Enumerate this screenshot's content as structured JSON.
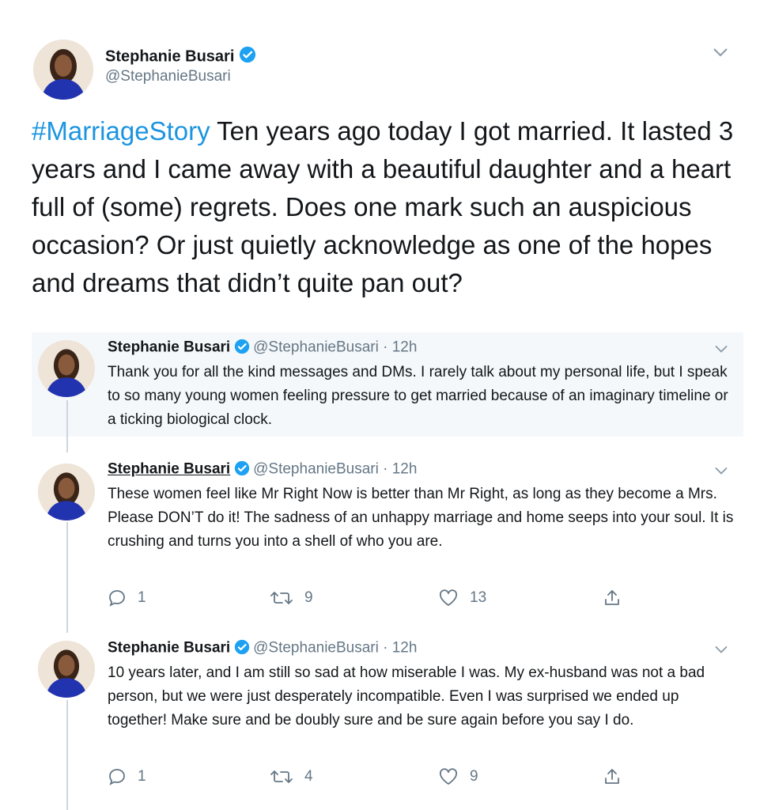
{
  "main_tweet": {
    "name": "Stephanie Busari",
    "handle": "@StephanieBusari",
    "hashtag": "#MarriageStory",
    "text": " Ten years ago today I got married. It lasted 3 years and I came away with a beautiful daughter and a heart full of (some) regrets. Does one mark such an auspicious occasion? Or just quietly acknowledge as one of the hopes and dreams that didn’t quite pan out?"
  },
  "replies": [
    {
      "name": "Stephanie Busari",
      "meta": "@StephanieBusari · 12h",
      "text": "Thank you for all the kind messages and DMs. I rarely talk about my personal life, but I speak to so many young women feeling pressure to get married because of an imaginary timeline or a ticking biological clock."
    },
    {
      "name": "Stephanie Busari",
      "meta": "@StephanieBusari · 12h",
      "text": "These women feel like Mr Right Now is better than Mr Right, as long as they become a Mrs. Please DON’T do it! The sadness of an unhappy marriage and home seeps into your soul. It is crushing and turns you into a shell of who you are.",
      "replies": "1",
      "retweets": "9",
      "likes": "13"
    },
    {
      "name": "Stephanie Busari",
      "meta": "@StephanieBusari · 12h",
      "text": "10 years later, and  I am still so sad at how miserable I was. My ex-husband was not a bad person, but we were just desperately incompatible. Even I was surprised we ended up together! Make sure and be doubly sure and be sure again before you say I do.",
      "replies": "1",
      "retweets": "4",
      "likes": "9"
    }
  ],
  "colors": {
    "accent": "#1b95e0",
    "muted": "#657786",
    "verified": "#1da1f2",
    "highlight_bg": "#f5f8fa"
  }
}
